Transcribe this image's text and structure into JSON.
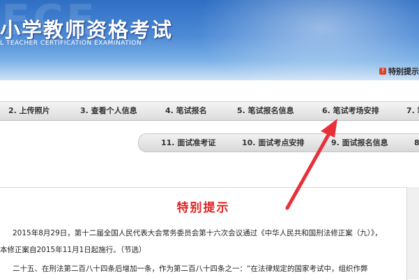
{
  "header": {
    "watermark": "ECE",
    "title": "小学教师资格考试",
    "subtitle": "L TEACHER CERTIFICATION EXAMINATION",
    "notice_icon": "?",
    "notice_label": "特别提示"
  },
  "nav_row1": [
    {
      "label": "2. 上传照片"
    },
    {
      "label": "3. 查看个人信息"
    },
    {
      "label": "4. 笔试报名"
    },
    {
      "label": "5. 笔试报名信息"
    },
    {
      "label": "6. 笔试考场安排"
    },
    {
      "label": "7. 笔"
    }
  ],
  "nav_row2": [
    {
      "label": "11. 面试准考证"
    },
    {
      "label": "10. 面试考点安排"
    },
    {
      "label": "9. 面试报名信息"
    },
    {
      "label": "8"
    }
  ],
  "content": {
    "heading": "特别提示",
    "line1": "2015年8月29日，第十二届全国人民代表大会常务委员会第十六次会议通过《中华人民共和国刑法修正案（九）》，",
    "line2": "本修正案自2015年11月1日起施行。（节选）",
    "line3": "二十五、在刑法第二百八十四条后增加一条，作为第二百八十四条之一：“在法律规定的国家考试中，组织作弊"
  },
  "colors": {
    "banner": "#3d7fd0",
    "heading": "#e02020",
    "arrow": "#e8303a"
  }
}
